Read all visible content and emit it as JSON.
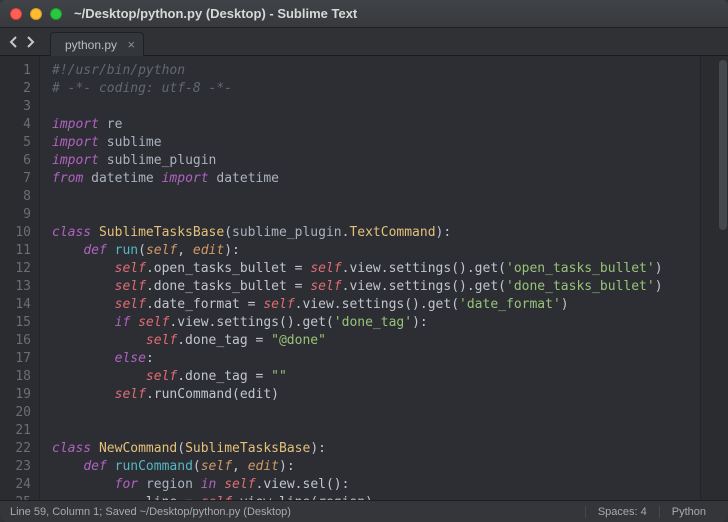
{
  "window": {
    "title": "~/Desktop/python.py (Desktop) - Sublime Text"
  },
  "tab": {
    "label": "python.py"
  },
  "status": {
    "left": "Line 59, Column 1; Saved ~/Desktop/python.py (Desktop)",
    "spaces": "Spaces: 4",
    "syntax": "Python"
  },
  "code": {
    "line_start": 1,
    "line_end": 25,
    "l1": "#!/usr/bin/python",
    "l2": "# -*- coding: utf-8 -*-",
    "l4a": "import",
    "l4b": "re",
    "l5a": "import",
    "l5b": "sublime",
    "l6a": "import",
    "l6b": "sublime_plugin",
    "l7a": "from",
    "l7b": "datetime",
    "l7c": "import",
    "l7d": "datetime",
    "l10a": "class",
    "l10b": "SublimeTasksBase",
    "l10c": "sublime_plugin",
    "l10d": "TextCommand",
    "l11a": "def",
    "l11b": "run",
    "l11c": "self",
    "l11d": "edit",
    "l12a": "self",
    "l12b": ".open_tasks_bullet = ",
    "l12c": "self",
    "l12d": ".view.settings().get(",
    "l12e": "'open_tasks_bullet'",
    "l12f": ")",
    "l13a": "self",
    "l13b": ".done_tasks_bullet = ",
    "l13c": "self",
    "l13d": ".view.settings().get(",
    "l13e": "'done_tasks_bullet'",
    "l13f": ")",
    "l14a": "self",
    "l14b": ".date_format = ",
    "l14c": "self",
    "l14d": ".view.settings().get(",
    "l14e": "'date_format'",
    "l14f": ")",
    "l15a": "if",
    "l15b": "self",
    "l15c": ".view.settings().get(",
    "l15d": "'done_tag'",
    "l15e": "):",
    "l16a": "self",
    "l16b": ".done_tag = ",
    "l16c": "\"@done\"",
    "l17a": "else",
    "l17b": ":",
    "l18a": "self",
    "l18b": ".done_tag = ",
    "l18c": "\"\"",
    "l19a": "self",
    "l19b": ".runCommand(edit)",
    "l22a": "class",
    "l22b": "NewCommand",
    "l22c": "SublimeTasksBase",
    "l23a": "def",
    "l23b": "runCommand",
    "l23c": "self",
    "l23d": "edit",
    "l24a": "for",
    "l24b": "region",
    "l24c": "in",
    "l24d": "self",
    "l24e": ".view.sel():",
    "l25a": "line = ",
    "l25b": "self",
    "l25c": ".view.line(region)"
  }
}
